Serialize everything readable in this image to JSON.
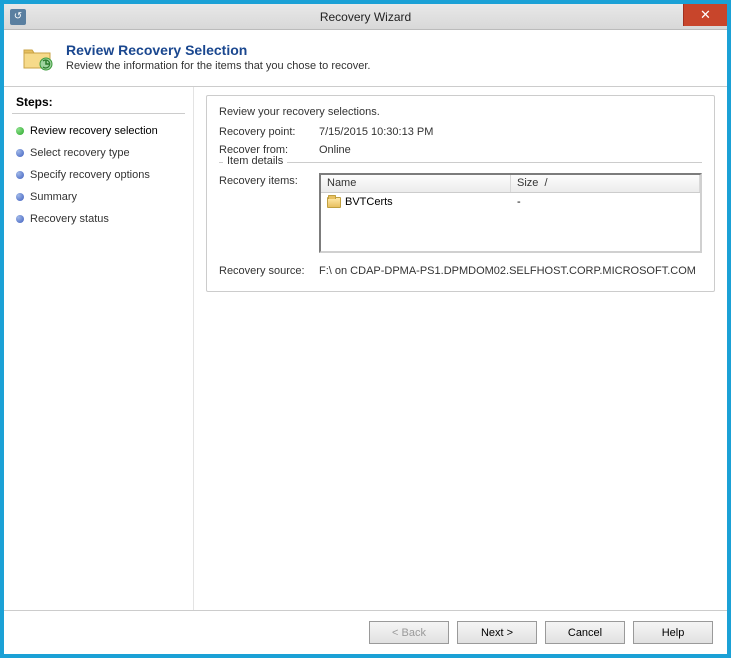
{
  "window": {
    "title": "Recovery Wizard"
  },
  "header": {
    "title": "Review Recovery Selection",
    "subtitle": "Review the information for the items that you chose to recover."
  },
  "sidebar": {
    "title": "Steps:",
    "steps": [
      {
        "label": "Review recovery selection"
      },
      {
        "label": "Select recovery type"
      },
      {
        "label": "Specify recovery options"
      },
      {
        "label": "Summary"
      },
      {
        "label": "Recovery status"
      }
    ]
  },
  "main": {
    "intro": "Review your recovery selections.",
    "recovery_point_label": "Recovery point:",
    "recovery_point_value": "7/15/2015 10:30:13 PM",
    "recover_from_label": "Recover from:",
    "recover_from_value": "Online",
    "item_details_legend": "Item details",
    "recovery_items_label": "Recovery items:",
    "columns": {
      "name": "Name",
      "size": "Size"
    },
    "items": [
      {
        "name": "BVTCerts",
        "size": "-"
      }
    ],
    "recovery_source_label": "Recovery source:",
    "recovery_source_value": "F:\\ on CDAP-DPMA-PS1.DPMDOM02.SELFHOST.CORP.MICROSOFT.COM"
  },
  "footer": {
    "back": "< Back",
    "next": "Next >",
    "cancel": "Cancel",
    "help": "Help"
  }
}
